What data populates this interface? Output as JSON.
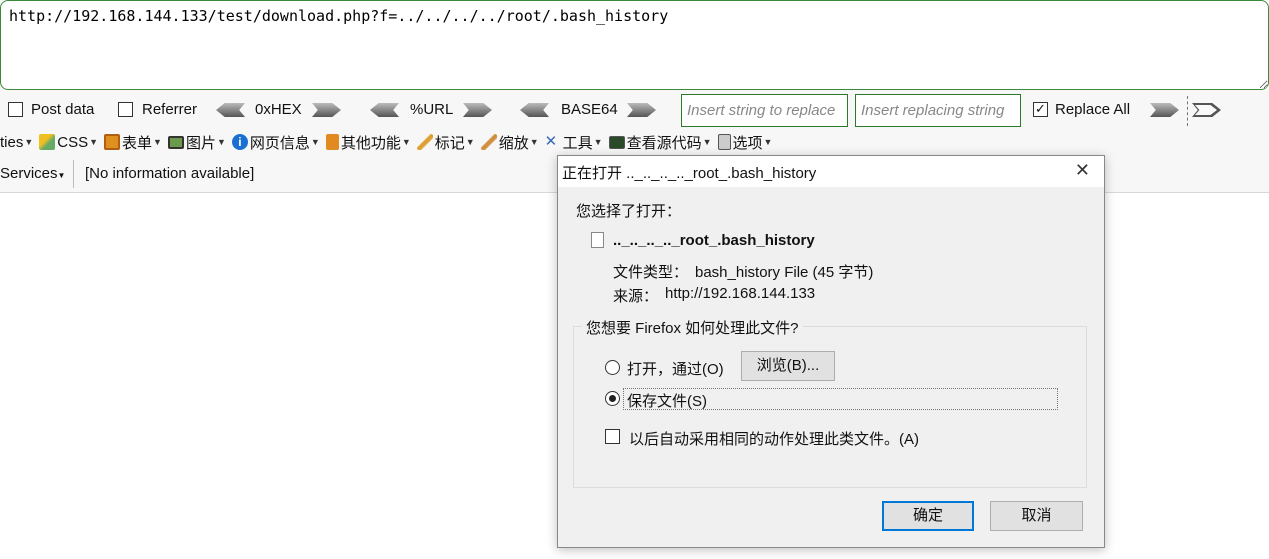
{
  "url_bar": {
    "value": "http://192.168.144.133/test/download.php?f=../../../../root/.bash_history"
  },
  "hackbar": {
    "post_data": {
      "label": "Post data",
      "checked": false
    },
    "referrer": {
      "label": "Referrer",
      "checked": false
    },
    "hex_label": "0xHEX",
    "url_label": "%URL",
    "base64_label": "BASE64",
    "replace_input_placeholder": "Insert string to replace",
    "replacing_input_placeholder": "Insert replacing string",
    "replace_all": {
      "label": "Replace All",
      "checked": true
    }
  },
  "toolbar": {
    "items": [
      {
        "label": "ties",
        "icon": "cookies-icon"
      },
      {
        "label": "CSS",
        "icon": "css-wand-icon"
      },
      {
        "label": "表单",
        "icon": "clipboard-form-icon"
      },
      {
        "label": "图片",
        "icon": "image-icon"
      },
      {
        "label": "网页信息",
        "icon": "info-icon"
      },
      {
        "label": "其他功能",
        "icon": "book-icon"
      },
      {
        "label": "标记",
        "icon": "pencil-icon"
      },
      {
        "label": "缩放",
        "icon": "ruler-icon"
      },
      {
        "label": "工具",
        "icon": "tools-icon"
      },
      {
        "label": "查看源代码",
        "icon": "source-icon"
      },
      {
        "label": "选项",
        "icon": "options-icon"
      }
    ]
  },
  "statusbar": {
    "services": "Services",
    "info": "[No information available]"
  },
  "dialog": {
    "title": "正在打开 .._.._.._.._root_.bash_history",
    "intro": "您选择了打开：",
    "file_name": ".._.._.._.._root_.bash_history",
    "file_type_label": "文件类型：",
    "file_type_value": "bash_history File (45 字节)",
    "source_label": "来源：",
    "source_value": "http://192.168.144.133",
    "group_title": "您想要 Firefox 如何处理此文件?",
    "open_with_label": "打开，通过(O)",
    "browse_button": "浏览(B)...",
    "save_file_label": "保存文件(S)",
    "selected_option": "save",
    "auto_label": "以后自动采用相同的动作处理此类文件。(A)",
    "auto_checked": false,
    "ok_button": "确定",
    "cancel_button": "取消"
  },
  "colors": {
    "accent_green": "#2a7a2a",
    "default_button_border": "#0078d7"
  }
}
